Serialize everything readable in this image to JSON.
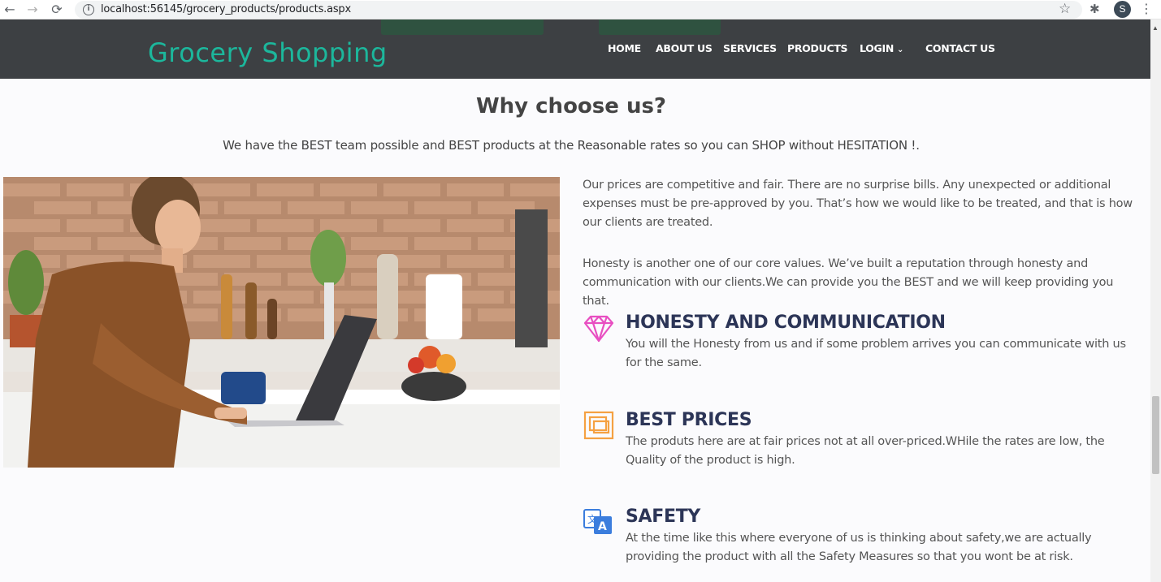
{
  "browser": {
    "url": "localhost:56145/grocery_products/products.aspx",
    "profile_initial": "S",
    "back_icon": "←",
    "forward_icon": "→",
    "reload_icon": "⟳",
    "info_icon": "i",
    "star_icon": "☆",
    "extensions_icon": "✱",
    "menu_icon": "⋮"
  },
  "header": {
    "brand": "Grocery Shopping",
    "nav": {
      "home": "HOME",
      "about": "ABOUT US",
      "services": "SERVICES",
      "products": "PRODUCTS",
      "login": "LOGIN",
      "login_caret": "⌄",
      "contact": "CONTACT US"
    }
  },
  "section": {
    "title": "Why choose us?",
    "subtitle": "We have the BEST team possible and BEST products at the Reasonable rates so you can SHOP without HESITATION !."
  },
  "paragraphs": {
    "p1": "Our prices are competitive and fair. There are no surprise bills. Any unexpected or additional expenses must be pre-approved by you. That’s how we would like to be treated, and that is how our clients are treated.",
    "p2": "Honesty is another one of our core values. We’ve built a reputation through honesty and communication with our clients.We can provide you the BEST and we will keep providing you that."
  },
  "features": {
    "honesty": {
      "title": "HONESTY AND COMMUNICATION",
      "desc": "You will the Honesty from us and if some problem arrives you can communicate with us for the same.",
      "icon": "diamond-icon",
      "color": "#e84fc1"
    },
    "prices": {
      "title": "BEST PRICES",
      "desc": "The produts here are at fair prices not at all over-priced.WHile the rates are low, the Quality of the product is high.",
      "icon": "frames-icon",
      "color": "#f5a142"
    },
    "safety": {
      "title": "SAFETY",
      "desc": "At the time like this where everyone of us is thinking about safety,we are actually providing the product with all the Safety Measures so that you wont be at risk.",
      "icon": "translate-icon",
      "color": "#3b7ddd"
    }
  },
  "colors": {
    "header_bg": "#3d4043",
    "brand": "#1cb79c",
    "heading": "#2c3557",
    "body_text": "#555555"
  }
}
